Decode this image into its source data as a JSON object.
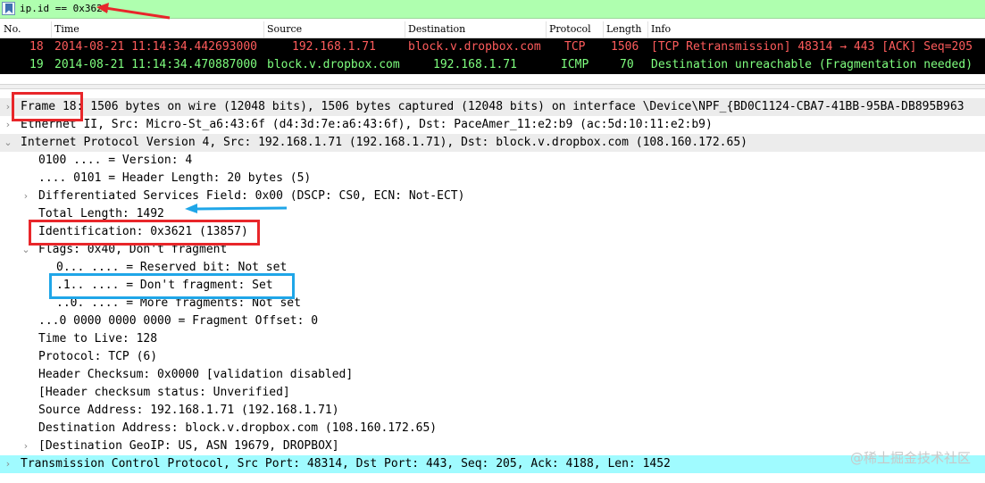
{
  "filter": {
    "text": "ip.id == 0x3621"
  },
  "columns": [
    "No.",
    "Time",
    "Source",
    "Destination",
    "Protocol",
    "Length",
    "Info"
  ],
  "packets": [
    {
      "no": "18",
      "time": "2014-08-21 11:14:34.442693000",
      "src": "192.168.1.71",
      "dst": "block.v.dropbox.com",
      "proto": "TCP",
      "len": "1506",
      "info": "[TCP Retransmission] 48314 → 443 [ACK] Seq=205"
    },
    {
      "no": "19",
      "time": "2014-08-21 11:14:34.470887000",
      "src": "block.v.dropbox.com",
      "dst": "192.168.1.71",
      "proto": "ICMP",
      "len": "70",
      "info": "Destination unreachable (Fragmentation needed)"
    }
  ],
  "details": [
    "Frame 18: 1506 bytes on wire (12048 bits), 1506 bytes captured (12048 bits) on interface \\Device\\NPF_{BD0C1124-CBA7-41BB-95BA-DB895B963",
    "Ethernet II, Src: Micro-St_a6:43:6f (d4:3d:7e:a6:43:6f), Dst: PaceAmer_11:e2:b9 (ac:5d:10:11:e2:b9)",
    "Internet Protocol Version 4, Src: 192.168.1.71 (192.168.1.71), Dst: block.v.dropbox.com (108.160.172.65)",
    "0100 .... = Version: 4",
    ".... 0101 = Header Length: 20 bytes (5)",
    "Differentiated Services Field: 0x00 (DSCP: CS0, ECN: Not-ECT)",
    "Total Length: 1492",
    "Identification: 0x3621 (13857)",
    "Flags: 0x40, Don't fragment",
    "0... .... = Reserved bit: Not set",
    ".1.. .... = Don't fragment: Set",
    "..0. .... = More fragments: Not set",
    "...0 0000 0000 0000 = Fragment Offset: 0",
    "Time to Live: 128",
    "Protocol: TCP (6)",
    "Header Checksum: 0x0000 [validation disabled]",
    "[Header checksum status: Unverified]",
    "Source Address: 192.168.1.71 (192.168.1.71)",
    "Destination Address: block.v.dropbox.com (108.160.172.65)",
    "[Destination GeoIP: US, ASN 19679, DROPBOX]",
    "Transmission Control Protocol, Src Port: 48314, Dst Port: 443, Seq: 205, Ack: 4188, Len: 1452"
  ],
  "watermark": "@稀土掘金技术社区",
  "colors": {
    "filter_bg": "#afffaf",
    "row_bg": "#000000",
    "row18_fg": "#ff5c5c",
    "row19_fg": "#7fff7f",
    "selected_bg": "#a0fbff",
    "annotation_red": "#e8262a",
    "annotation_blue": "#1fa6e8"
  }
}
